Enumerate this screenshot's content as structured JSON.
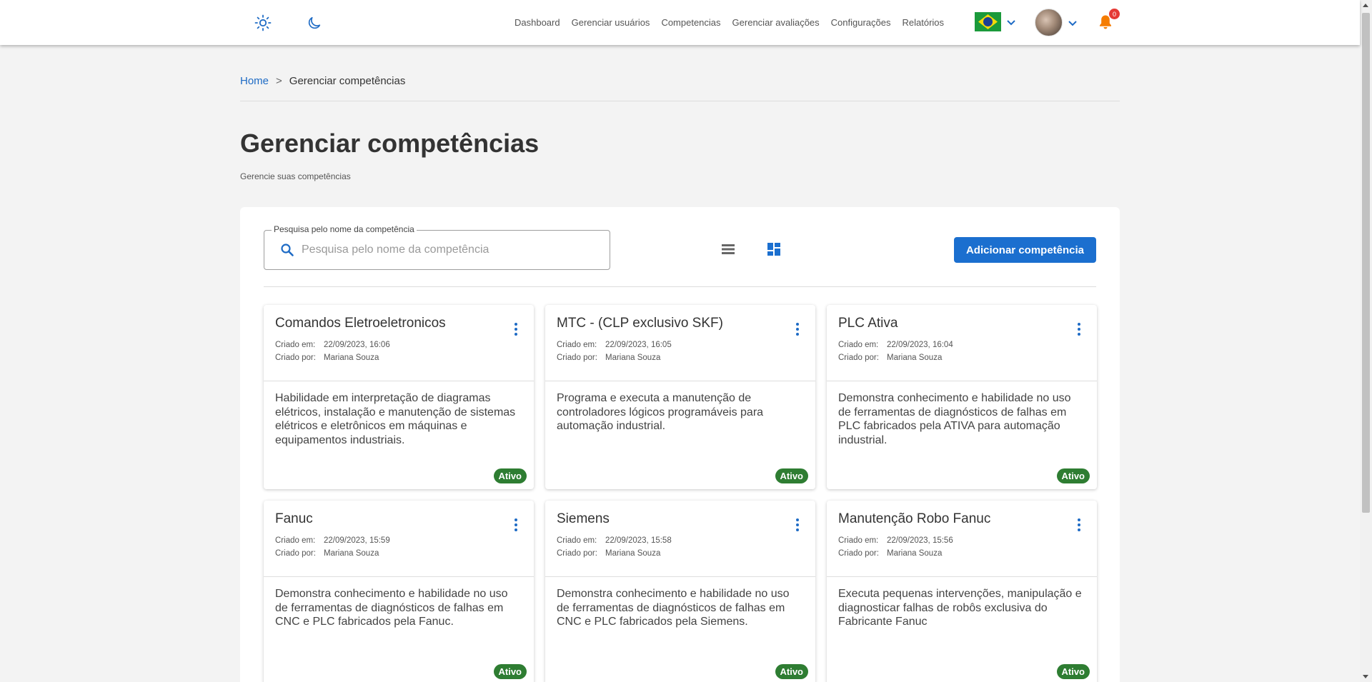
{
  "nav": {
    "items": [
      "Dashboard",
      "Gerenciar usuários",
      "Competencias",
      "Gerenciar avaliações",
      "Configurações",
      "Relatórios"
    ],
    "notification_count": "0"
  },
  "breadcrumb": {
    "home": "Home",
    "separator": ">",
    "current": "Gerenciar competências"
  },
  "page": {
    "title": "Gerenciar competências",
    "subtitle": "Gerencie suas competências"
  },
  "search": {
    "legend": "Pesquisa pelo nome da competência",
    "placeholder": "Pesquisa pelo nome da competência",
    "value": ""
  },
  "actions": {
    "add_label": "Adicionar competência"
  },
  "colors": {
    "primary": "#1b6fcf",
    "status_active": "#2e7d32",
    "notification": "#f57c00"
  },
  "cards": [
    {
      "title": "Comandos Eletroeletronicos",
      "created_at_label": "Criado em:",
      "created_at": "22/09/2023, 16:06",
      "created_by_label": "Criado por:",
      "created_by": "Mariana Souza",
      "description": "Habilidade em interpretação de diagramas elétricos, instalação e manutenção de sistemas elétricos e eletrônicos em máquinas e equipamentos industriais.",
      "status": "Ativo"
    },
    {
      "title": "MTC - (CLP exclusivo SKF)",
      "created_at_label": "Criado em:",
      "created_at": "22/09/2023, 16:05",
      "created_by_label": "Criado por:",
      "created_by": "Mariana Souza",
      "description": "Programa e executa a manutenção de controladores lógicos programáveis para automação industrial.",
      "status": "Ativo"
    },
    {
      "title": "PLC Ativa",
      "created_at_label": "Criado em:",
      "created_at": "22/09/2023, 16:04",
      "created_by_label": "Criado por:",
      "created_by": "Mariana Souza",
      "description": "Demonstra conhecimento e habilidade no uso de ferramentas de diagnósticos de falhas em PLC fabricados pela ATIVA para automação industrial.",
      "status": "Ativo"
    },
    {
      "title": "Fanuc",
      "created_at_label": "Criado em:",
      "created_at": "22/09/2023, 15:59",
      "created_by_label": "Criado por:",
      "created_by": "Mariana Souza",
      "description": "Demonstra conhecimento e habilidade no uso de ferramentas de diagnósticos de falhas em CNC e PLC fabricados pela Fanuc.",
      "status": "Ativo"
    },
    {
      "title": "Siemens",
      "created_at_label": "Criado em:",
      "created_at": "22/09/2023, 15:58",
      "created_by_label": "Criado por:",
      "created_by": "Mariana Souza",
      "description": "Demonstra conhecimento e habilidade no uso de ferramentas de diagnósticos de falhas em CNC e PLC fabricados pela Siemens.",
      "status": "Ativo"
    },
    {
      "title": "Manutenção Robo Fanuc",
      "created_at_label": "Criado em:",
      "created_at": "22/09/2023, 15:56",
      "created_by_label": "Criado por:",
      "created_by": "Mariana Souza",
      "description": "Executa pequenas intervenções, manipulação e diagnosticar falhas de robôs exclusiva do Fabricante Fanuc",
      "status": "Ativo"
    }
  ]
}
